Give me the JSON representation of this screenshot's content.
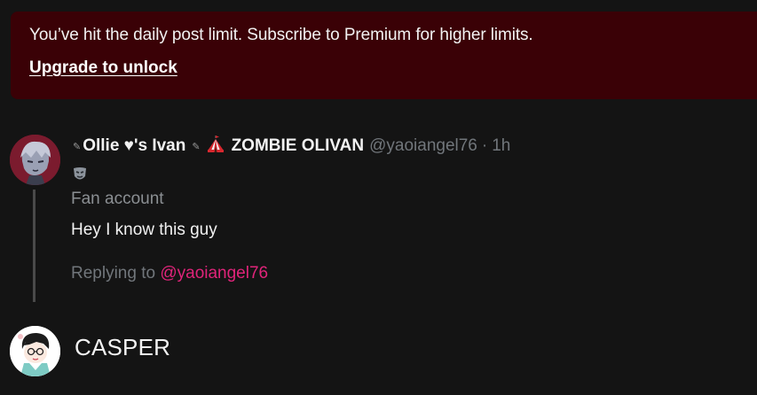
{
  "banner": {
    "message": "You’ve hit the daily post limit. Subscribe to Premium for higher limits.",
    "upgrade_label": "Upgrade to unlock"
  },
  "post": {
    "name_part1": "Ollie ♥'s Ivan",
    "name_part2": "ZOMBIE OLIVAN",
    "handle": "@yaoiangel76",
    "separator": "·",
    "time": "1h",
    "bio_label": "Fan account",
    "text": "Hey I know this guy",
    "replying_prefix": "Replying to ",
    "replying_handle": "@yaoiangel76"
  },
  "next_post": {
    "name": "CASPER"
  },
  "colors": {
    "banner_bg": "#3a0106",
    "page_bg": "#141414",
    "mention": "#e0247a",
    "muted": "#71767b"
  }
}
